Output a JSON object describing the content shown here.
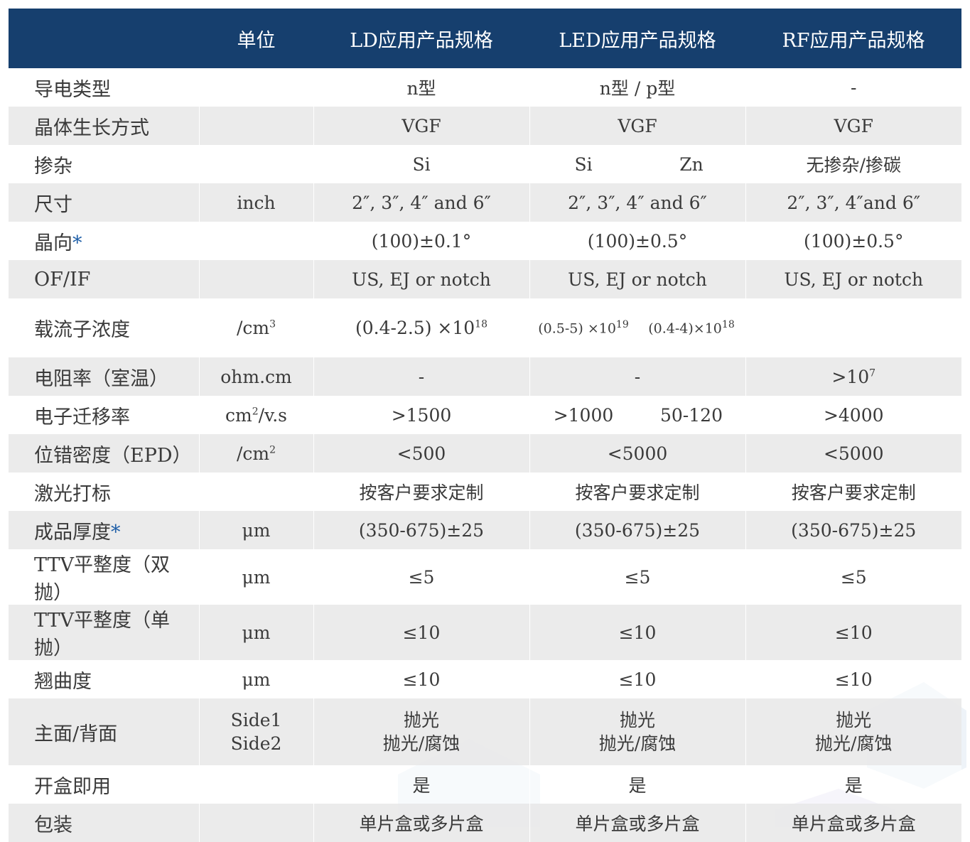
{
  "header": {
    "unit": "单位",
    "ld": "LD应用产品规格",
    "led": "LED应用产品规格",
    "rf": "RF应用产品规格"
  },
  "rows": {
    "conductivity": {
      "label": "导电类型",
      "unit": "",
      "ld": "n型",
      "led": "n型 / p型",
      "rf": "-"
    },
    "growth": {
      "label": "晶体生长方式",
      "unit": "",
      "ld": "VGF",
      "led": "VGF",
      "rf": "VGF"
    },
    "dopant": {
      "label": "掺杂",
      "unit": "",
      "ld": "Si",
      "led_a": "Si",
      "led_b": "Zn",
      "rf": "无掺杂/掺碳"
    },
    "size": {
      "label": "尺寸",
      "unit": "inch",
      "ld": "2″, 3″, 4″ and 6″",
      "led": "2″, 3″, 4″ and 6″",
      "rf": "2″, 3″, 4″and 6″"
    },
    "orientation": {
      "label": "晶向",
      "star": "*",
      "unit": "",
      "ld": "(100)±0.1°",
      "led": "(100)±0.5°",
      "rf": "(100)±0.5°"
    },
    "of_if": {
      "label": "OF/IF",
      "unit": "",
      "ld": "US, EJ or notch",
      "led": "US, EJ or notch",
      "rf": "US, EJ or notch"
    },
    "carrier": {
      "label": "载流子浓度",
      "unit_base": "/cm",
      "unit_exp": "3",
      "ld_base": "(0.4-2.5) ×10",
      "ld_exp": "18",
      "led_a_base": "(0.5-5) ×10",
      "led_a_exp": "19",
      "led_b_base": "(0.4-4)×10",
      "led_b_exp": "18",
      "rf": ""
    },
    "resistivity": {
      "label": "电阻率（室温）",
      "unit": "ohm.cm",
      "ld": "-",
      "led": "-",
      "rf_base": ">10",
      "rf_exp": "7"
    },
    "mobility": {
      "label": "电子迁移率",
      "unit_base": "cm",
      "unit_exp": "2",
      "unit_tail": "/v.s",
      "ld": ">1500",
      "led_a": ">1000",
      "led_b": "50-120",
      "rf": ">4000"
    },
    "epd": {
      "label": "位错密度（EPD）",
      "unit_base": "/cm",
      "unit_exp": "2",
      "ld": "<500",
      "led": "<5000",
      "rf": "<5000"
    },
    "laser": {
      "label": "激光打标",
      "unit": "",
      "ld": "按客户要求定制",
      "led": "按客户要求定制",
      "rf": "按客户要求定制"
    },
    "thickness": {
      "label": "成品厚度",
      "star": "*",
      "unit": "μm",
      "ld": "(350-675)±25",
      "led": "(350-675)±25",
      "rf": "(350-675)±25"
    },
    "ttv_double": {
      "label": "TTV平整度（双抛）",
      "unit": "μm",
      "ld": "≤5",
      "led": "≤5",
      "rf": "≤5"
    },
    "ttv_single": {
      "label": "TTV平整度（单抛）",
      "unit": "μm",
      "ld": "≤10",
      "led": "≤10",
      "rf": "≤10"
    },
    "warp": {
      "label": "翘曲度",
      "unit": "μm",
      "ld": "≤10",
      "led": "≤10",
      "rf": "≤10"
    },
    "surface": {
      "label": "主面/背面",
      "unit_1": "Side1",
      "unit_2": "Side2",
      "ld_1": "抛光",
      "ld_2": "抛光/腐蚀",
      "led_1": "抛光",
      "led_2": "抛光/腐蚀",
      "rf_1": "抛光",
      "rf_2": "抛光/腐蚀"
    },
    "epi_ready": {
      "label": "开盒即用",
      "unit": "",
      "ld": "是",
      "led": "是",
      "rf": "是"
    },
    "packing": {
      "label": "包装",
      "unit": "",
      "ld": "单片盒或多片盒",
      "led": "单片盒或多片盒",
      "rf": "单片盒或多片盒"
    }
  }
}
